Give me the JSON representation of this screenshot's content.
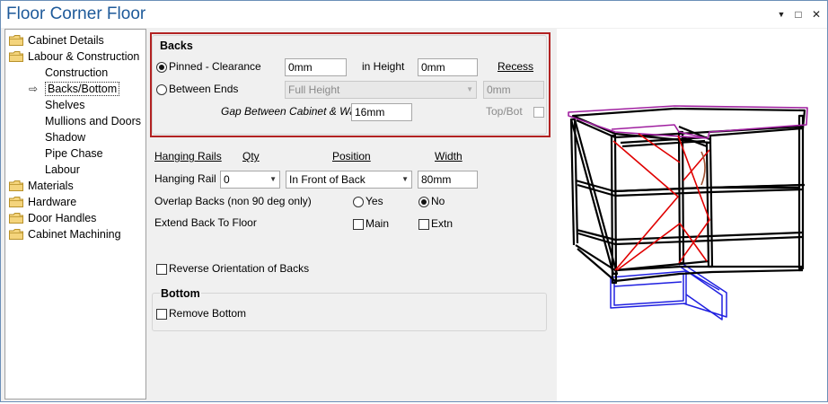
{
  "window": {
    "title": "Floor Corner Floor"
  },
  "titlebar_buttons": {
    "dropdown": "▼",
    "maximize": "□",
    "close": "✕"
  },
  "tree": {
    "items": [
      {
        "label": "Cabinet Details",
        "icon": "folder-icon"
      },
      {
        "label": "Labour & Construction",
        "icon": "folder-icon"
      },
      {
        "label": "Construction"
      },
      {
        "label": "Backs/Bottom",
        "selected": true
      },
      {
        "label": "Shelves"
      },
      {
        "label": "Mullions and Doors"
      },
      {
        "label": "Shadow"
      },
      {
        "label": "Pipe Chase"
      },
      {
        "label": "Labour"
      },
      {
        "label": "Materials",
        "icon": "folder-icon"
      },
      {
        "label": "Hardware",
        "icon": "folder-icon"
      },
      {
        "label": "Door Handles",
        "icon": "folder-icon"
      },
      {
        "label": "Cabinet Machining",
        "icon": "folder-icon"
      }
    ]
  },
  "backs": {
    "heading": "Backs",
    "pinned_label": "Pinned - Clearance",
    "pinned_value": "0mm",
    "in_height_label": "in Height",
    "in_height_value": "0mm",
    "recess_label": "Recess",
    "between_ends_label": "Between Ends",
    "full_height_value": "Full Height",
    "between_value": "0mm",
    "gap_label": "Gap Between Cabinet & Wall",
    "gap_value": "16mm",
    "topbot_label": "Top/Bot"
  },
  "hanging": {
    "col_rails": "Hanging Rails",
    "col_qty": "Qty",
    "col_position": "Position",
    "col_width": "Width",
    "row_label": "Hanging Rail",
    "qty_value": "0",
    "position_value": "In Front of Back",
    "width_value": "80mm"
  },
  "overlap": {
    "label": "Overlap Backs (non 90 deg only)",
    "yes": "Yes",
    "no": "No"
  },
  "extend": {
    "label": "Extend Back To Floor",
    "main": "Main",
    "extn": "Extn"
  },
  "reverse_label": "Reverse Orientation of Backs",
  "bottom": {
    "heading": "Bottom",
    "remove_label": "Remove Bottom"
  },
  "colors": {
    "title": "#1e5a9a",
    "highlight_border": "#b22222",
    "frame": "#000000",
    "diag": "#e00000",
    "top_outline": "#a020a0",
    "base_outline": "#2020e0"
  }
}
